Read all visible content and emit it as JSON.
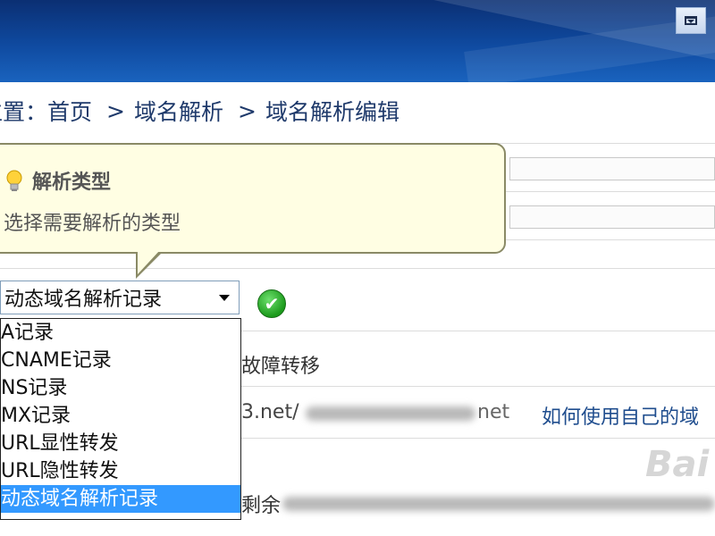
{
  "breadcrumb": {
    "prefix": "位置：",
    "items": [
      "首页",
      "域名解析",
      "域名解析编辑"
    ],
    "separator": ">"
  },
  "tooltip": {
    "title": "解析类型",
    "text": "选择需要解析的类型"
  },
  "record_type_select": {
    "value": "动态域名解析记录",
    "options": [
      "A记录",
      "CNAME记录",
      "NS记录",
      "MX记录",
      "URL显性转发",
      "URL隐性转发",
      "动态域名解析记录"
    ],
    "selected_index": 6
  },
  "background": {
    "failover_text": "故障转移",
    "domain_suffix": "3.net/",
    "domain_tail": "net",
    "help_link": "如何使用自己的域",
    "remain_text": "剩余",
    "watermark": "Bai"
  },
  "colors": {
    "header": "#0f4aa0",
    "tooltip_bg": "#fffee3",
    "selection": "#3399ff",
    "link": "#1f4d8e"
  },
  "icons": {
    "ok": "check-circle-icon",
    "tip": "lightbulb-icon",
    "window": "dropdown-window-icon"
  }
}
